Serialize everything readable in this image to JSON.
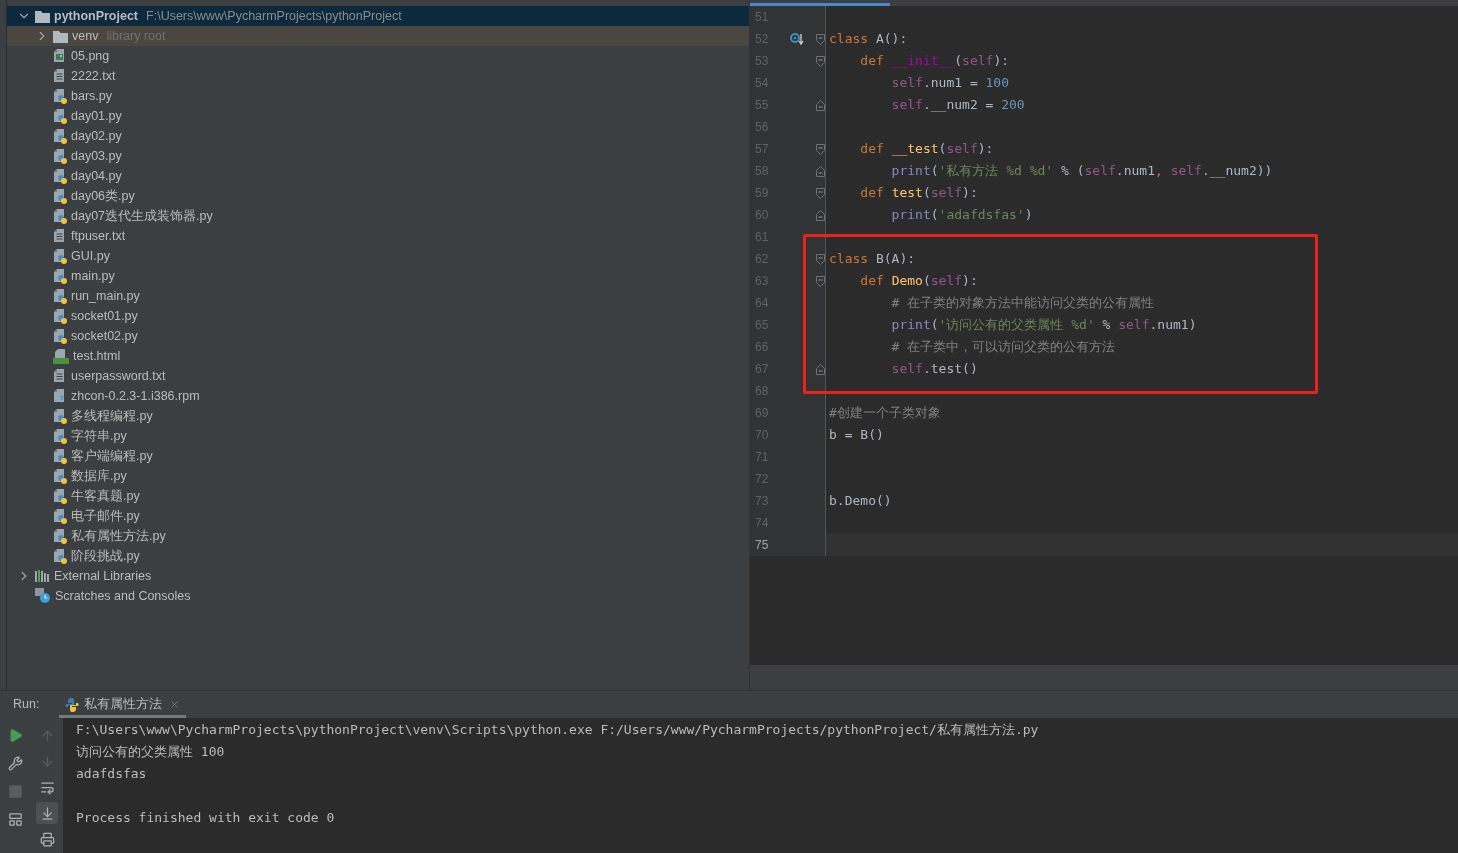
{
  "project_tree": [
    {
      "name": "pythonProject",
      "path": "F:\\Users\\www\\PycharmProjects\\pythonProject",
      "kind": "project",
      "expanded": true,
      "selected": true,
      "children": [
        {
          "name": "venv",
          "hint": "library root",
          "kind": "library_folder",
          "expanded": false,
          "selected": false
        },
        {
          "name": "05.png",
          "kind": "image",
          "selected": false
        },
        {
          "name": "2222.txt",
          "kind": "text",
          "selected": false
        },
        {
          "name": "bars.py",
          "kind": "python",
          "selected": false
        },
        {
          "name": "day01.py",
          "kind": "python",
          "selected": false
        },
        {
          "name": "day02.py",
          "kind": "python",
          "selected": false
        },
        {
          "name": "day03.py",
          "kind": "python",
          "selected": false
        },
        {
          "name": "day04.py",
          "kind": "python",
          "selected": false
        },
        {
          "name": "day06类.py",
          "kind": "python",
          "selected": false
        },
        {
          "name": "day07迭代生成装饰器.py",
          "kind": "python",
          "selected": false
        },
        {
          "name": "ftpuser.txt",
          "kind": "text",
          "selected": false
        },
        {
          "name": "GUI.py",
          "kind": "python",
          "selected": false
        },
        {
          "name": "main.py",
          "kind": "python",
          "selected": false
        },
        {
          "name": "run_main.py",
          "kind": "python",
          "selected": false
        },
        {
          "name": "socket01.py",
          "kind": "python",
          "selected": false
        },
        {
          "name": "socket02.py",
          "kind": "python",
          "selected": false
        },
        {
          "name": "test.html",
          "kind": "html",
          "selected": false
        },
        {
          "name": "userpassword.txt",
          "kind": "text",
          "selected": false
        },
        {
          "name": "zhcon-0.2.3-1.i386.rpm",
          "kind": "unknown",
          "selected": false
        },
        {
          "name": "多线程编程.py",
          "kind": "python",
          "selected": false
        },
        {
          "name": "字符串.py",
          "kind": "python",
          "selected": false
        },
        {
          "name": "客户端编程.py",
          "kind": "python",
          "selected": false
        },
        {
          "name": "数据库.py",
          "kind": "python",
          "selected": false
        },
        {
          "name": "牛客真题.py",
          "kind": "python",
          "selected": false
        },
        {
          "name": "电子邮件.py",
          "kind": "python",
          "selected": false
        },
        {
          "name": "私有属性方法.py",
          "kind": "python",
          "selected": false
        },
        {
          "name": "阶段挑战.py",
          "kind": "python",
          "selected": false
        }
      ]
    },
    {
      "name": "External Libraries",
      "kind": "libraries",
      "expanded": false,
      "selected": false
    },
    {
      "name": "Scratches and Consoles",
      "kind": "scratches",
      "selected": false
    }
  ],
  "editor": {
    "lines": [
      {
        "number": "51"
      },
      {
        "number": "52",
        "override_marker": true,
        "fold_start": true,
        "tokens": [
          {
            "kind": "kw",
            "text": "class"
          },
          {
            "kind": "plain",
            "text": " A():"
          }
        ]
      },
      {
        "number": "53",
        "fold_start": true,
        "tokens": [
          {
            "kind": "kw",
            "text": "    def "
          },
          {
            "kind": "magic",
            "text": "__init__"
          },
          {
            "kind": "plain",
            "text": "("
          },
          {
            "kind": "self",
            "text": "self"
          },
          {
            "kind": "plain",
            "text": "):"
          }
        ]
      },
      {
        "number": "54",
        "tokens": [
          {
            "kind": "self",
            "text": "        self"
          },
          {
            "kind": "plain",
            "text": ".num1 = "
          },
          {
            "kind": "num",
            "text": "100"
          }
        ]
      },
      {
        "number": "55",
        "fold_end": true,
        "tokens": [
          {
            "kind": "self",
            "text": "        self"
          },
          {
            "kind": "plain",
            "text": ".__num2 = "
          },
          {
            "kind": "num",
            "text": "200"
          }
        ]
      },
      {
        "number": "56"
      },
      {
        "number": "57",
        "fold_start": true,
        "tokens": [
          {
            "kind": "kw",
            "text": "    def "
          },
          {
            "kind": "fn",
            "text": "__test"
          },
          {
            "kind": "plain",
            "text": "("
          },
          {
            "kind": "self",
            "text": "self"
          },
          {
            "kind": "plain",
            "text": "):"
          }
        ]
      },
      {
        "number": "58",
        "fold_end": true,
        "tokens": [
          {
            "kind": "builtin",
            "text": "        print"
          },
          {
            "kind": "plain",
            "text": "("
          },
          {
            "kind": "str",
            "text": "'私有方法 %d %d'"
          },
          {
            "kind": "plain",
            "text": " % ("
          },
          {
            "kind": "self",
            "text": "self"
          },
          {
            "kind": "plain",
            "text": ".num1"
          },
          {
            "kind": "kw",
            "text": ", "
          },
          {
            "kind": "self",
            "text": "self"
          },
          {
            "kind": "plain",
            "text": ".__num2))"
          }
        ]
      },
      {
        "number": "59",
        "fold_start": true,
        "tokens": [
          {
            "kind": "kw",
            "text": "    def "
          },
          {
            "kind": "fn",
            "text": "test"
          },
          {
            "kind": "plain",
            "text": "("
          },
          {
            "kind": "self",
            "text": "self"
          },
          {
            "kind": "plain",
            "text": "):"
          }
        ]
      },
      {
        "number": "60",
        "fold_end": true,
        "tokens": [
          {
            "kind": "builtin",
            "text": "        print"
          },
          {
            "kind": "plain",
            "text": "("
          },
          {
            "kind": "str",
            "text": "'adafdsfas'"
          },
          {
            "kind": "plain",
            "text": ")"
          }
        ]
      },
      {
        "number": "61"
      },
      {
        "number": "62",
        "fold_start": true,
        "boxed": true,
        "tokens": [
          {
            "kind": "kw",
            "text": "class"
          },
          {
            "kind": "plain",
            "text": " B(A):"
          }
        ]
      },
      {
        "number": "63",
        "fold_start": true,
        "boxed": true,
        "tokens": [
          {
            "kind": "kw",
            "text": "    def "
          },
          {
            "kind": "fn",
            "text": "Demo"
          },
          {
            "kind": "plain",
            "text": "("
          },
          {
            "kind": "self",
            "text": "self"
          },
          {
            "kind": "plain",
            "text": "):"
          }
        ]
      },
      {
        "number": "64",
        "boxed": true,
        "tokens": [
          {
            "kind": "cm",
            "text": "        # 在子类的对象方法中能访问父类的公有属性"
          }
        ]
      },
      {
        "number": "65",
        "boxed": true,
        "tokens": [
          {
            "kind": "builtin",
            "text": "        print"
          },
          {
            "kind": "plain",
            "text": "("
          },
          {
            "kind": "str",
            "text": "'访问公有的父类属性 %d'"
          },
          {
            "kind": "plain",
            "text": " % "
          },
          {
            "kind": "self",
            "text": "self"
          },
          {
            "kind": "plain",
            "text": ".num1)"
          }
        ]
      },
      {
        "number": "66",
        "boxed": true,
        "tokens": [
          {
            "kind": "cm",
            "text": "        # 在子类中，可以访问父类的公有方法"
          }
        ]
      },
      {
        "number": "67",
        "fold_end": true,
        "boxed": true,
        "tokens": [
          {
            "kind": "self",
            "text": "        self"
          },
          {
            "kind": "plain",
            "text": ".test()"
          }
        ]
      },
      {
        "number": "68"
      },
      {
        "number": "69",
        "tokens": [
          {
            "kind": "cm",
            "text": "#创建一个子类对象"
          }
        ]
      },
      {
        "number": "70",
        "tokens": [
          {
            "kind": "plain",
            "text": "b = B()"
          }
        ]
      },
      {
        "number": "71"
      },
      {
        "number": "72"
      },
      {
        "number": "73",
        "tokens": [
          {
            "kind": "plain",
            "text": "b.Demo()"
          }
        ]
      },
      {
        "number": "74"
      },
      {
        "number": "75",
        "current": true
      }
    ]
  },
  "run": {
    "label": "Run:",
    "tab": {
      "title": "私有属性方法",
      "selected": true
    },
    "tools_left": [
      {
        "kind": "run",
        "disabled": false,
        "pressed": false
      },
      {
        "kind": "settings",
        "disabled": false,
        "pressed": false
      },
      {
        "kind": "stop",
        "disabled": true,
        "pressed": false
      },
      {
        "kind": "layout",
        "disabled": false,
        "pressed": false
      }
    ],
    "tools_right": [
      {
        "kind": "up",
        "disabled": true,
        "pressed": false
      },
      {
        "kind": "down",
        "disabled": true,
        "pressed": false
      },
      {
        "kind": "wrap",
        "disabled": false,
        "pressed": false
      },
      {
        "kind": "scroll_end",
        "disabled": false,
        "pressed": true
      },
      {
        "kind": "print",
        "disabled": false,
        "pressed": false
      }
    ],
    "output": [
      {
        "kind": "command",
        "text": "F:\\Users\\www\\PycharmProjects\\pythonProject\\venv\\Scripts\\python.exe F:/Users/www/PycharmProjects/pythonProject/私有属性方法.py"
      },
      {
        "kind": "stdout",
        "text": "访问公有的父类属性 100"
      },
      {
        "kind": "stdout",
        "text": "adafdsfas"
      },
      {
        "kind": "exit",
        "text": "Process finished with exit code 0"
      }
    ]
  }
}
